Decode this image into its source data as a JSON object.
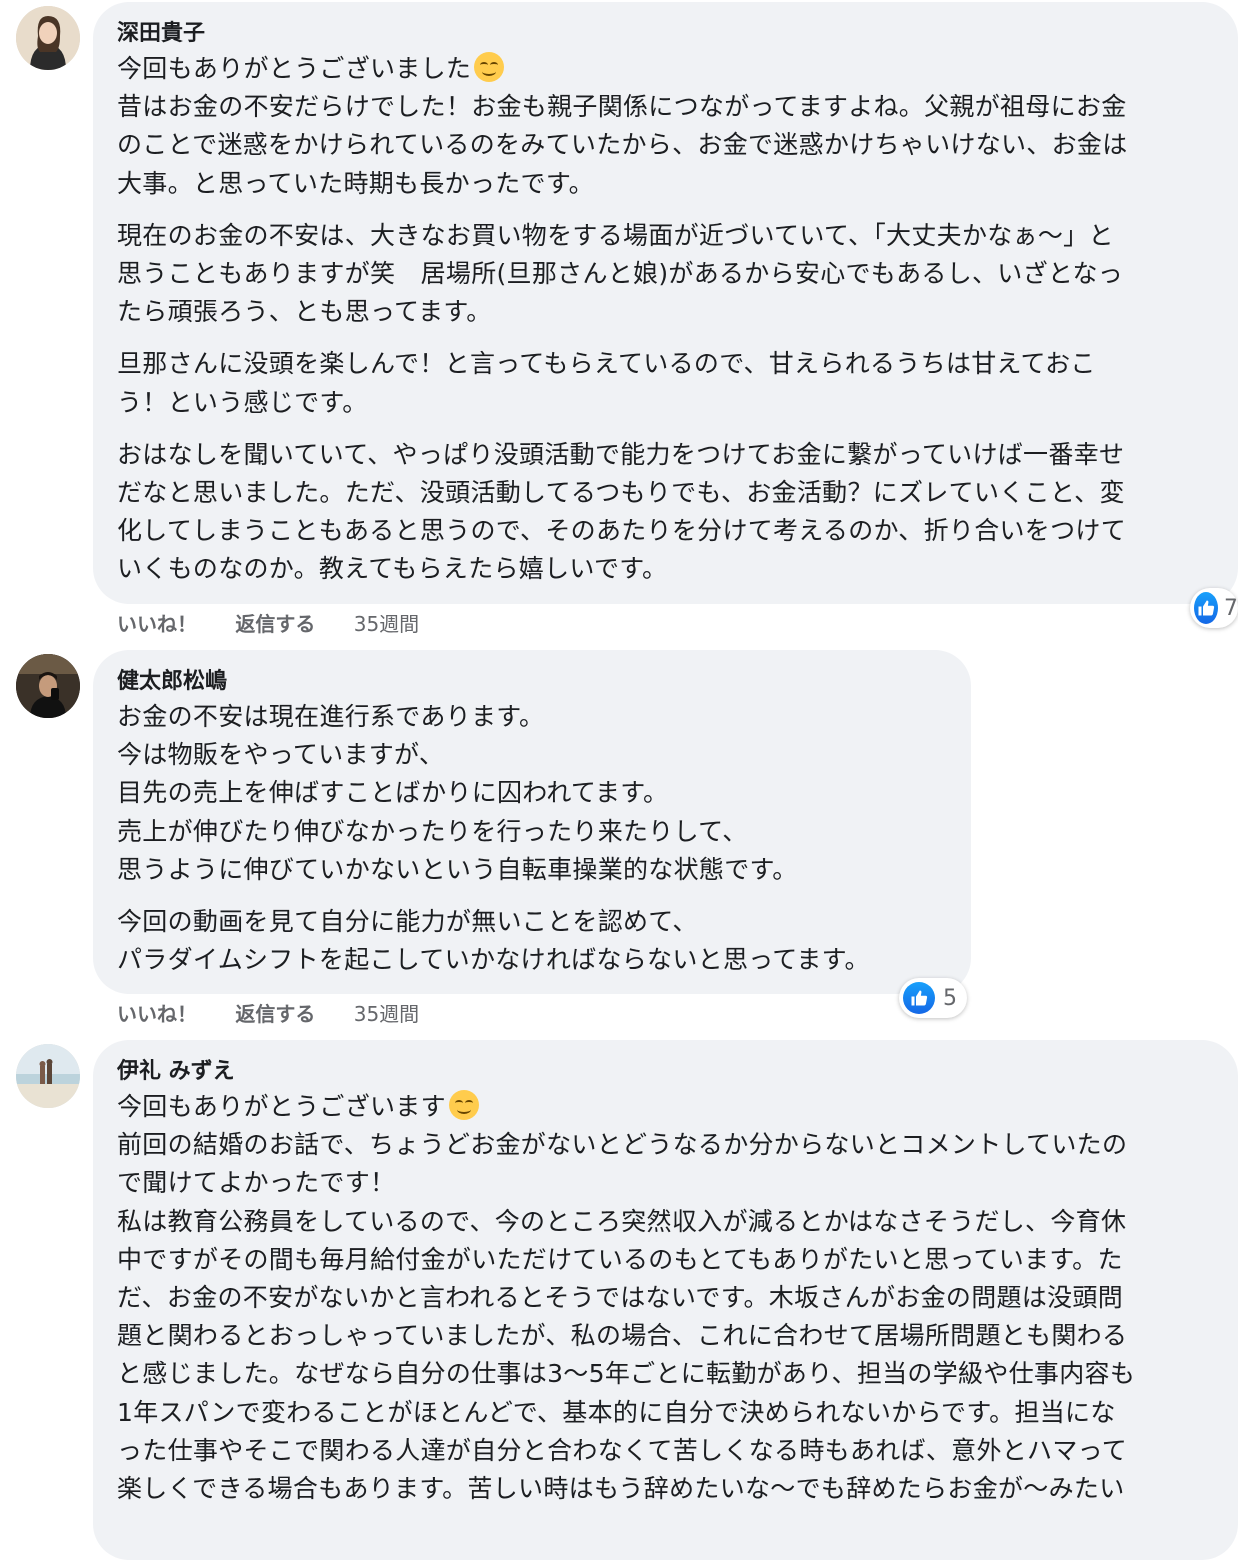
{
  "comments": [
    {
      "author": "深田貴子",
      "paragraphs": [
        [
          "今回もありがとうございました",
          "昔はお金の不安だらけでした！お金も親子関係につながってますよね。父親が祖母にお金",
          "のことで迷惑をかけられているのをみていたから、お金で迷惑かけちゃいけない、お金は",
          "大事。と思っていた時期も長かったです。"
        ],
        [
          "現在のお金の不安は、大きなお買い物をする場面が近づいていて、「大丈夫かなぁ〜」と",
          "思うこともありますが笑　居場所(旦那さんと娘)があるから安心でもあるし、いざとなっ",
          "たら頑張ろう、とも思ってます。"
        ],
        [
          "旦那さんに没頭を楽しんで！と言ってもらえているので、甘えられるうちは甘えておこ",
          "う！という感じです。"
        ],
        [
          "おはなしを聞いていて、やっぱり没頭活動で能力をつけてお金に繋がっていけば一番幸せ",
          "だなと思いました。ただ、没頭活動してるつもりでも、お金活動？にズレていくこと、変",
          "化してしまうこともあると思うので、そのあたりを分けて考えるのか、折り合いをつけて",
          "いくものなのか。教えてもらえたら嬉しいです。"
        ]
      ],
      "emoji": "smiling-face-emoji",
      "actions": {
        "like": "いいね！",
        "reply": "返信する",
        "time": "35週間"
      },
      "reaction_count": "7"
    },
    {
      "author": "健太郎松嶋",
      "paragraphs": [
        [
          "お金の不安は現在進行系であります。",
          "今は物販をやっていますが、",
          "目先の売上を伸ばすことばかりに囚われてます。",
          "売上が伸びたり伸びなかったりを行ったり来たりして、",
          "思うように伸びていかないという自転車操業的な状態です。"
        ],
        [
          "今回の動画を見て自分に能力が無いことを認めて、",
          "パラダイムシフトを起こしていかなければならないと思ってます。"
        ]
      ],
      "actions": {
        "like": "いいね！",
        "reply": "返信する",
        "time": "35週間"
      },
      "reaction_count": "5"
    },
    {
      "author": "伊礼 みずえ",
      "paragraphs": [
        [
          "今回もありがとうございます",
          "前回の結婚のお話で、ちょうどお金がないとどうなるか分からないとコメントしていたの",
          "で聞けてよかったです！",
          "私は教育公務員をしているので、今のところ突然収入が減るとかはなさそうだし、今育休",
          "中ですがその間も毎月給付金がいただけているのもとてもありがたいと思っています。た",
          "だ、お金の不安がないかと言われるとそうではないです。木坂さんがお金の問題は没頭問",
          "題と関わるとおっしゃっていましたが、私の場合、これに合わせて居場所問題とも関わる",
          "と感じました。なぜなら自分の仕事は3〜5年ごとに転勤があり、担当の学級や仕事内容も",
          "1年スパンで変わることがほとんどで、基本的に自分で決められないからです。担当にな",
          "った仕事やそこで関わる人達が自分と合わなくて苦しくなる時もあれば、意外とハマって",
          "楽しくできる場合もあります。苦しい時はもう辞めたいな〜でも辞めたらお金が〜みたい"
        ]
      ],
      "emoji": "smiling-face-emoji"
    }
  ],
  "colors": {
    "bubble": "#f0f2f5",
    "meta_text": "#65676b",
    "like_blue": "#1877f2"
  },
  "icons": [
    "like-thumb-icon",
    "smiling-face-emoji"
  ]
}
